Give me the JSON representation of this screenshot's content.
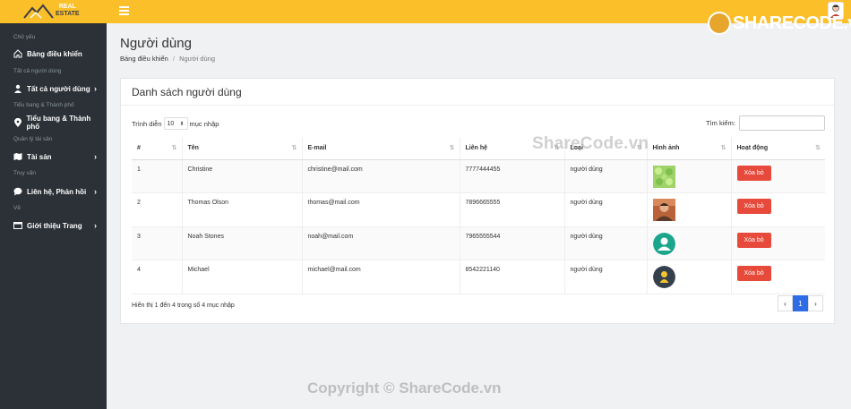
{
  "brand": {
    "line1": "REAL",
    "line2": "ESTATE"
  },
  "sidebar": {
    "sections": [
      {
        "label": "Chủ yếu"
      },
      {
        "label": "Tất cả người dùng"
      },
      {
        "label": "Tiểu bang & Thành phố"
      },
      {
        "label": "Quản lý tài sản"
      },
      {
        "label": "Truy vấn"
      },
      {
        "label": "Về"
      }
    ],
    "items": [
      {
        "label": "Bảng điều khiển",
        "icon": "home-icon"
      },
      {
        "label": "Tất cả người dùng",
        "icon": "user-icon"
      },
      {
        "label": "Tiểu bang & Thành phố",
        "icon": "map-pin-icon"
      },
      {
        "label": "Tài sản",
        "icon": "map-icon"
      },
      {
        "label": "Liên hệ, Phản hồi",
        "icon": "chat-icon"
      },
      {
        "label": "Giới thiệu Trang",
        "icon": "window-icon"
      }
    ]
  },
  "header": {
    "title": "Người dùng",
    "breadcrumb_home": "Bảng điều khiển",
    "breadcrumb_sep": "/",
    "breadcrumb_current": "Người dùng"
  },
  "card": {
    "title": "Danh sách người dùng",
    "show_label": "Trình diễn",
    "page_size": "10",
    "entries_label": "mục nhập",
    "search_label": "Tìm kiếm:",
    "search_value": "",
    "columns": [
      "#",
      "Tên",
      "E-mail",
      "Liên hệ",
      "Loại",
      "Hình ảnh",
      "Hoạt động"
    ],
    "rows": [
      {
        "id": "1",
        "name": "Christine",
        "email": "christine@mail.com",
        "phone": "7777444455",
        "type": "người dùng",
        "image": "pattern",
        "action": "Xóa bỏ"
      },
      {
        "id": "2",
        "name": "Thomas Olson",
        "email": "thomas@mail.com",
        "phone": "7896665555",
        "type": "người dùng",
        "image": "photo",
        "action": "Xóa bỏ"
      },
      {
        "id": "3",
        "name": "Noah Stones",
        "email": "noah@mail.com",
        "phone": "7965555544",
        "type": "người dùng",
        "image": "avatar-teal",
        "action": "Xóa bỏ"
      },
      {
        "id": "4",
        "name": "Michael",
        "email": "michael@mail.com",
        "phone": "8542221140",
        "type": "người dùng",
        "image": "avatar-dark",
        "action": "Xóa bỏ"
      }
    ],
    "info": "Hiển thị 1 đến 4 trong số 4 mục nhập",
    "pager": {
      "prev": "‹",
      "current": "1",
      "next": "›"
    }
  },
  "watermarks": {
    "logo": "SHARECODE.vn",
    "middle": "ShareCode.vn",
    "bottom": "Copyright © ShareCode.vn"
  },
  "colors": {
    "topbar": "#fbbf2a",
    "sidebar": "#2b3137",
    "delete": "#e74a3b",
    "pager_active": "#2e6be6"
  }
}
